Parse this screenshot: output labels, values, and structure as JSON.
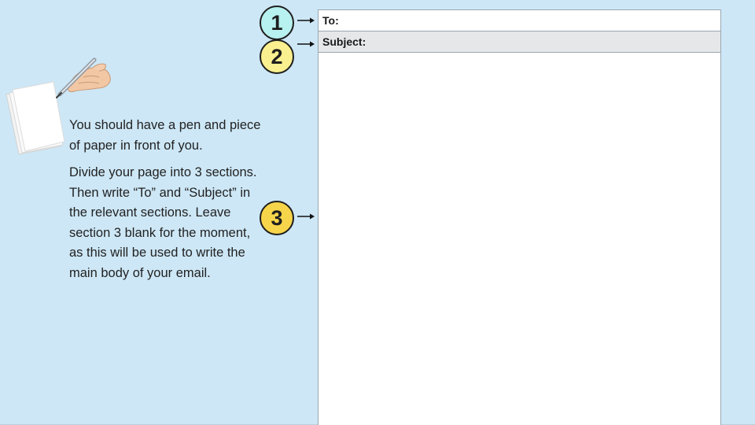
{
  "instructions": {
    "paragraph1": "You should have a pen and piece of paper in front of you.",
    "paragraph2": "Divide your page into 3 sections. Then write “To” and “Subject” in the relevant sections. Leave section 3 blank for the moment, as this will be used to write the main body of your email."
  },
  "markers": [
    {
      "label": "1",
      "color": "#b7f1f0"
    },
    {
      "label": "2",
      "color": "#fbf08f"
    },
    {
      "label": "3",
      "color": "#f7d54b"
    }
  ],
  "email_form": {
    "to_label": "To:",
    "subject_label": "Subject:"
  },
  "illustration": {
    "icon": "hand-writing-with-pen-on-paper-icon"
  },
  "colors": {
    "background": "#cde7f6",
    "subject_row": "#e6e7e9"
  }
}
